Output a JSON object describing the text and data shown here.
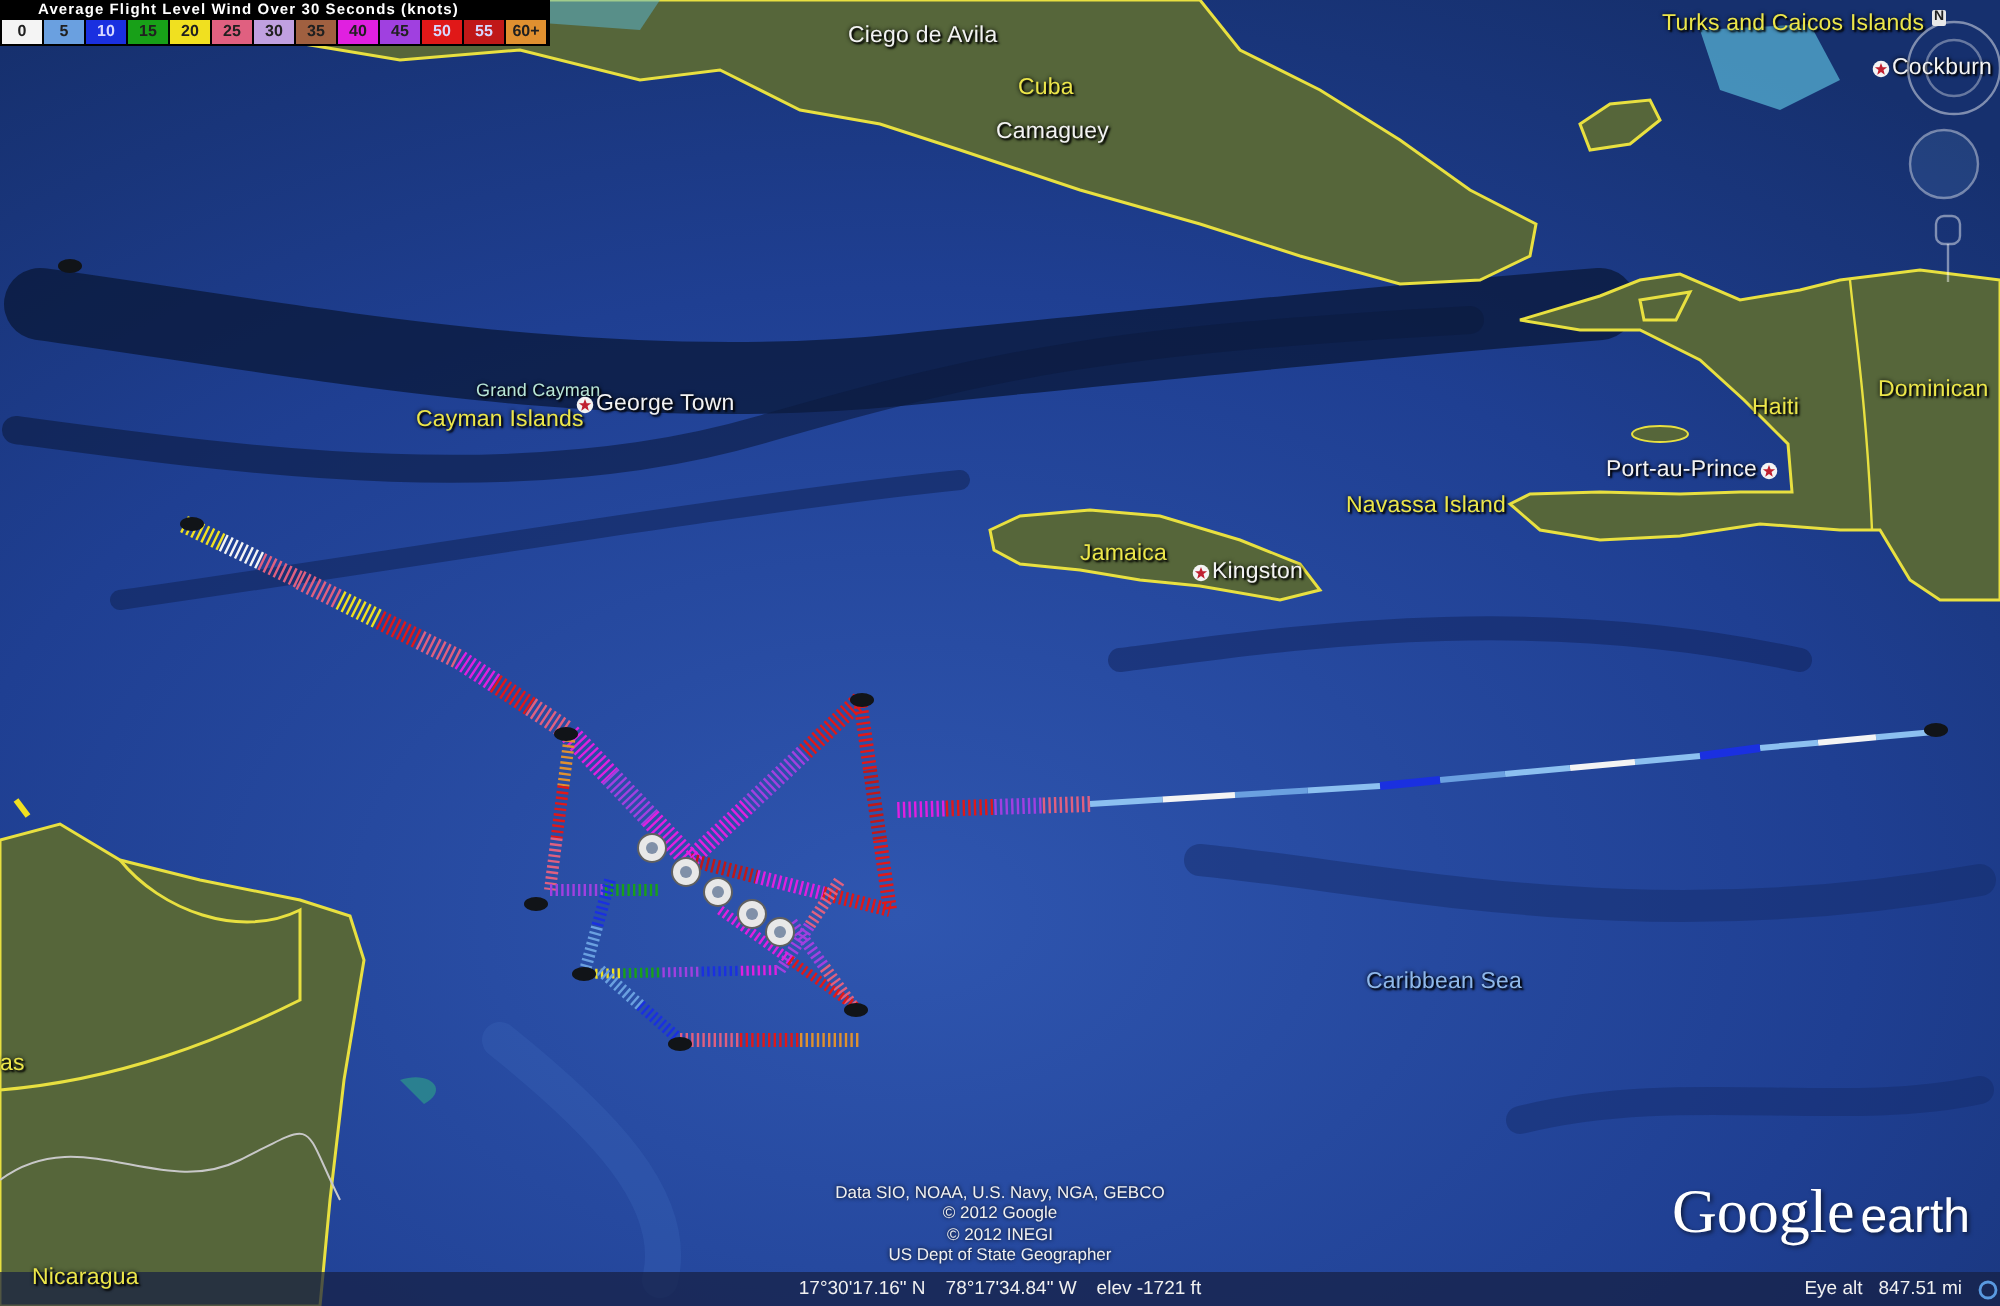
{
  "legend": {
    "title": "Average Flight Level Wind Over 30 Seconds (knots)",
    "items": [
      {
        "label": "0",
        "color": "#f4f4f4"
      },
      {
        "label": "5",
        "color": "#6aa0e0"
      },
      {
        "label": "10",
        "color": "#1a30e0"
      },
      {
        "label": "15",
        "color": "#18a018"
      },
      {
        "label": "20",
        "color": "#f0e020"
      },
      {
        "label": "25",
        "color": "#e06080"
      },
      {
        "label": "30",
        "color": "#c0a0e0"
      },
      {
        "label": "35",
        "color": "#a06040"
      },
      {
        "label": "40",
        "color": "#e020e0"
      },
      {
        "label": "45",
        "color": "#a040e0"
      },
      {
        "label": "50",
        "color": "#e01818"
      },
      {
        "label": "55",
        "color": "#c01818"
      },
      {
        "label": "60+",
        "color": "#e09030"
      }
    ]
  },
  "map_labels": [
    {
      "text": "Ciego de Avila",
      "kind": "place"
    },
    {
      "text": "Cuba",
      "kind": "country"
    },
    {
      "text": "Camaguey",
      "kind": "place"
    },
    {
      "text": "Turks and Caicos Islands",
      "kind": "country"
    },
    {
      "text": "Cockburn",
      "kind": "city"
    },
    {
      "text": "Grand Cayman",
      "kind": "island"
    },
    {
      "text": "Cayman Islands",
      "kind": "country"
    },
    {
      "text": "George Town",
      "kind": "city"
    },
    {
      "text": "Haiti",
      "kind": "country"
    },
    {
      "text": "Dominican",
      "kind": "country"
    },
    {
      "text": "Port-au-Prince",
      "kind": "city"
    },
    {
      "text": "Navassa Island",
      "kind": "country"
    },
    {
      "text": "Jamaica",
      "kind": "country"
    },
    {
      "text": "Kingston",
      "kind": "city"
    },
    {
      "text": "Caribbean Sea",
      "kind": "water"
    },
    {
      "text": "as",
      "kind": "country"
    },
    {
      "text": "Nicaragua",
      "kind": "country"
    }
  ],
  "navigation": {
    "north_label": "N"
  },
  "attribution": [
    "Data SIO, NOAA, U.S. Navy, NGA, GEBCO",
    "© 2012 Google",
    "© 2012 INEGI",
    "US Dept of State Geographer"
  ],
  "logo": {
    "brand": "Google",
    "product": "earth"
  },
  "status_bar": {
    "latitude": "17°30'17.16\" N",
    "longitude": "78°17'34.84\" W",
    "elevation": "elev -1721 ft",
    "eye_alt_label": "Eye alt",
    "eye_alt_value": "847.51 mi"
  }
}
